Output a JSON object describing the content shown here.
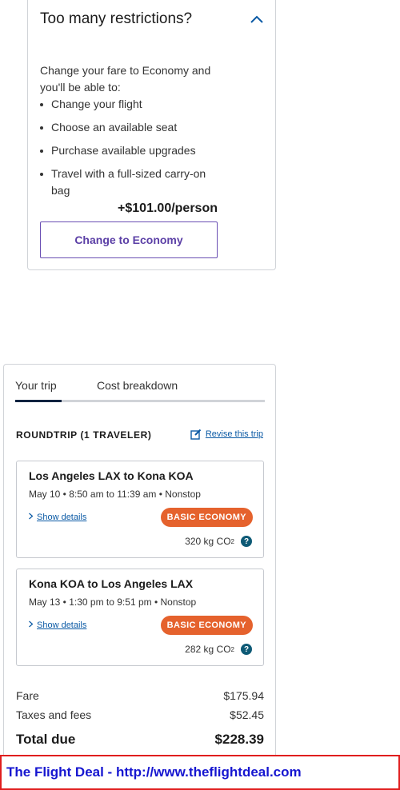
{
  "upsell": {
    "title": "Too many restrictions?",
    "intro": "Change your fare to Economy and you'll be able to:",
    "benefits": [
      "Change your flight",
      "Choose an available seat",
      "Purchase available upgrades",
      "Travel with a full-sized carry-on bag"
    ],
    "price": "+$101.00/person",
    "button_label": "Change to Economy",
    "collapse_icon": "chevron-up"
  },
  "trip": {
    "tabs": [
      "Your trip",
      "Cost breakdown"
    ],
    "active_tab": "Your trip",
    "heading": "ROUNDTRIP (1 TRAVELER)",
    "revise_label": "Revise this trip",
    "segments": [
      {
        "route": "Los Angeles LAX to Kona KOA",
        "times": "May 10 • 8:50 am to 11:39 am • Nonstop",
        "details_label": "Show details",
        "fare_class": "BASIC ECONOMY",
        "co2_value": "320 kg CO",
        "co2_sub": "2"
      },
      {
        "route": "Kona KOA to Los Angeles LAX",
        "times": "May 13 • 1:30 pm to 9:51 pm • Nonstop",
        "details_label": "Show details",
        "fare_class": "BASIC ECONOMY",
        "co2_value": "282 kg CO",
        "co2_sub": "2"
      }
    ],
    "costs": {
      "fare_label": "Fare",
      "fare_value": "$175.94",
      "taxes_label": "Taxes and fees",
      "taxes_value": "$52.45",
      "total_label": "Total due",
      "total_value": "$228.39"
    }
  },
  "footer": {
    "text": "The Flight Deal - http://www.theflightdeal.com"
  },
  "colors": {
    "accent_purple": "#5b3fa6",
    "badge_orange": "#e5622d",
    "link_blue": "#0b5aa5",
    "tab_indicator": "#0c2340",
    "footer_border": "#e01e1e",
    "footer_text": "#1616d0"
  }
}
